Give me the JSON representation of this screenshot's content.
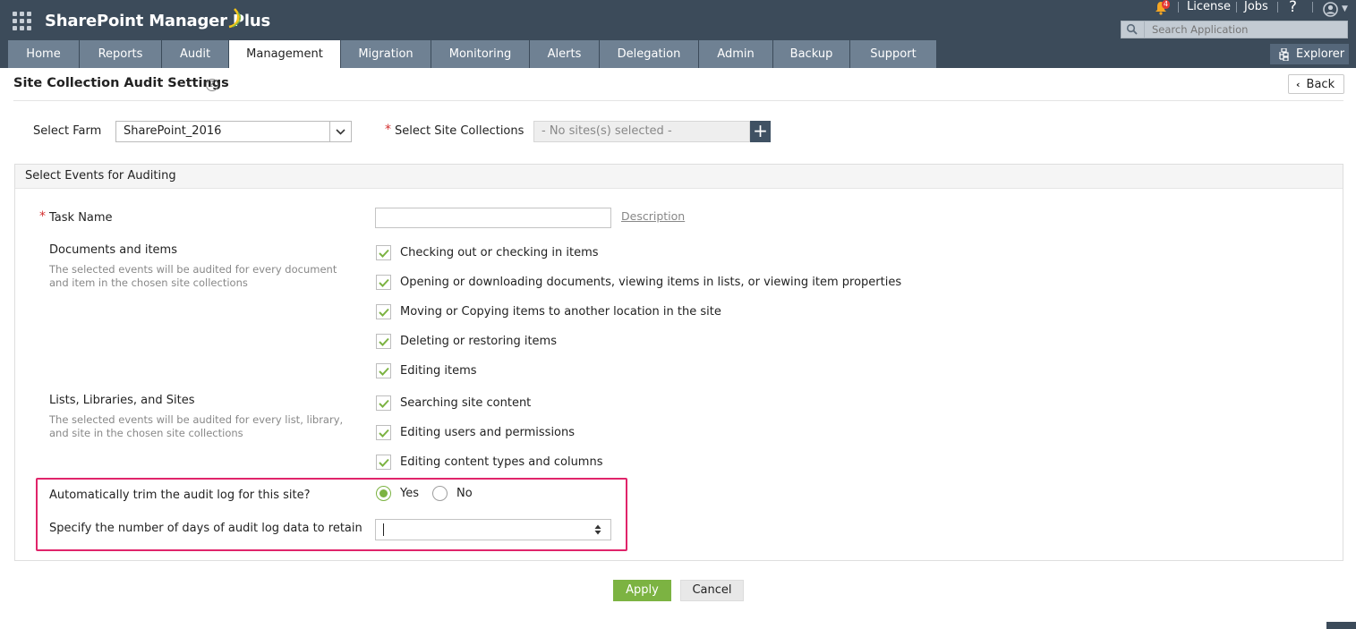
{
  "app": {
    "name": "SharePoint Manager Plus"
  },
  "topbar": {
    "notification_count": "4",
    "license_label": "License",
    "jobs_label": "Jobs",
    "help_label": "?",
    "search_placeholder": "Search Application"
  },
  "tabs": [
    {
      "label": "Home",
      "active": false
    },
    {
      "label": "Reports",
      "active": false
    },
    {
      "label": "Audit",
      "active": false
    },
    {
      "label": "Management",
      "active": true
    },
    {
      "label": "Migration",
      "active": false
    },
    {
      "label": "Monitoring",
      "active": false
    },
    {
      "label": "Alerts",
      "active": false
    },
    {
      "label": "Delegation",
      "active": false
    },
    {
      "label": "Admin",
      "active": false
    },
    {
      "label": "Backup",
      "active": false
    },
    {
      "label": "Support",
      "active": false
    }
  ],
  "explorer_label": "Explorer",
  "page": {
    "title": "Site Collection Audit Settings",
    "help": "?",
    "back_label": "Back"
  },
  "farm": {
    "label": "Select Farm",
    "value": "SharePoint_2016"
  },
  "sites": {
    "required_mark": "*",
    "label": "Select Site Collections",
    "value": "- No sites(s) selected -",
    "add": "+"
  },
  "panel": {
    "title": "Select Events for Auditing",
    "task_required_mark": "*",
    "task_label": "Task Name",
    "task_value": "",
    "description_link": "Description",
    "documents": {
      "title": "Documents and items",
      "help": "The selected events will be audited for every document and item in the chosen site collections",
      "events": [
        {
          "label": "Checking out or checking in items",
          "checked": true
        },
        {
          "label": "Opening or downloading documents, viewing items in lists, or viewing item properties",
          "checked": true
        },
        {
          "label": "Moving or Copying items to another location in the site",
          "checked": true
        },
        {
          "label": "Deleting or restoring items",
          "checked": true
        },
        {
          "label": "Editing items",
          "checked": true
        }
      ]
    },
    "lists": {
      "title": "Lists, Libraries, and Sites",
      "help": "The selected events will be audited for every list, library, and site in the chosen site collections",
      "events": [
        {
          "label": "Searching site content",
          "checked": true
        },
        {
          "label": "Editing users and permissions",
          "checked": true
        },
        {
          "label": "Editing content types and columns",
          "checked": true
        }
      ]
    },
    "trim": {
      "label": "Automatically trim the audit log for this site?",
      "yes_label": "Yes",
      "no_label": "No",
      "selected": "Yes"
    },
    "retain": {
      "label": "Specify the number of days of audit log data to retain",
      "value": ""
    }
  },
  "actions": {
    "apply_label": "Apply",
    "cancel_label": "Cancel"
  },
  "colors": {
    "topbar": "#3c4b5a",
    "tab": "#6f8193",
    "accent_green": "#7cb342",
    "highlight": "#e0246a",
    "required": "#d32f2f"
  }
}
